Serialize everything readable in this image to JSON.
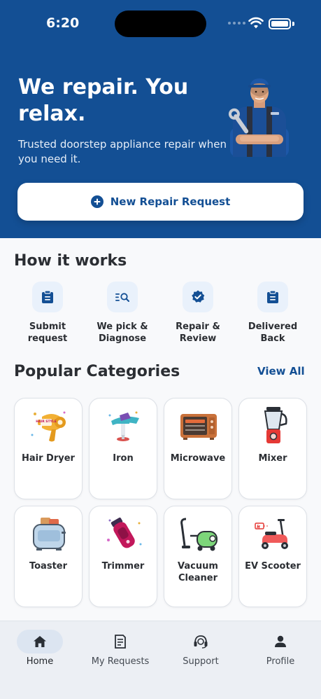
{
  "status_bar": {
    "time": "6:20"
  },
  "hero": {
    "title": "We repair. You relax.",
    "subtitle": "Trusted doorstep appliance repair when you need it.",
    "cta_label": "New Repair Request"
  },
  "how_it_works": {
    "title": "How it works",
    "steps": [
      {
        "label": "Submit request",
        "icon": "clipboard-icon"
      },
      {
        "label": "We pick & Diagnose",
        "icon": "list-search-icon"
      },
      {
        "label": "Repair & Review",
        "icon": "verified-badge-icon"
      },
      {
        "label": "Delivered Back",
        "icon": "clipboard-icon"
      }
    ]
  },
  "categories": {
    "title": "Popular Categories",
    "view_all": "View All",
    "items": [
      {
        "label": "Hair Dryer",
        "icon": "hair-dryer-icon",
        "logo_text": "HAIR STYLE"
      },
      {
        "label": "Iron",
        "icon": "iron-icon"
      },
      {
        "label": "Microwave",
        "icon": "microwave-icon"
      },
      {
        "label": "Mixer",
        "icon": "mixer-icon"
      },
      {
        "label": "Toaster",
        "icon": "toaster-icon"
      },
      {
        "label": "Trimmer",
        "icon": "trimmer-icon"
      },
      {
        "label": "Vacuum Cleaner",
        "icon": "vacuum-cleaner-icon"
      },
      {
        "label": "EV Scooter",
        "icon": "ev-scooter-icon"
      }
    ]
  },
  "bottom_nav": {
    "items": [
      {
        "label": "Home",
        "icon": "home-icon",
        "active": true
      },
      {
        "label": "My Requests",
        "icon": "requests-icon",
        "active": false
      },
      {
        "label": "Support",
        "icon": "support-icon",
        "active": false
      },
      {
        "label": "Profile",
        "icon": "profile-icon",
        "active": false
      }
    ]
  },
  "colors": {
    "brand": "#134f94",
    "background": "#f8f9fb",
    "card_border": "#dde1e7",
    "step_icon_bg": "#e9f1fb",
    "nav_bg": "#eceff4"
  }
}
